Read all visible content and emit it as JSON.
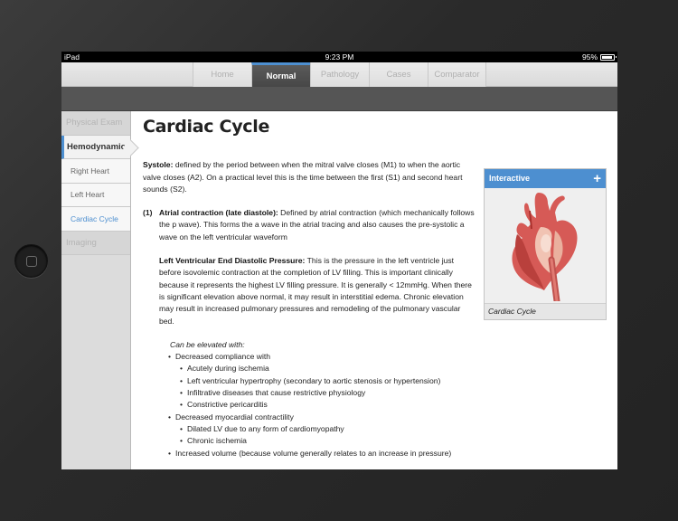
{
  "status": {
    "device": "iPad",
    "time": "9:23 PM",
    "battery": "95%"
  },
  "tabs": [
    {
      "label": "Home"
    },
    {
      "label": "Normal"
    },
    {
      "label": "Pathology"
    },
    {
      "label": "Cases"
    },
    {
      "label": "Comparator"
    }
  ],
  "active_tab": "Normal",
  "sidebar": {
    "items": [
      {
        "label": "Physical Exam"
      },
      {
        "label": "Hemodynamics"
      },
      {
        "label": "Right Heart"
      },
      {
        "label": "Left Heart"
      },
      {
        "label": "Cardiac Cycle"
      },
      {
        "label": "Imaging"
      }
    ]
  },
  "main": {
    "title": "Cardiac Cycle",
    "systole_label": "Systole:",
    "systole_text": " defined by the period between when the mitral valve closes (M1) to when the aortic valve closes (A2).  On a practical level this is the time between the first (S1) and second heart sounds (S2).",
    "item1_num": "(1)",
    "item1_label": "Atrial contraction (late diastole):",
    "item1_text": " Defined by atrial contraction (which mechanically follows the p wave). This forms the a wave in the atrial tracing and also causes the pre-systolic a wave on the left ventricular waveform",
    "lvedp_label": "Left Ventricular End Diastolic Pressure:",
    "lvedp_text": " This is the pressure in the left ventricle just before isovolemic contraction at the completion of LV filling.  This is important clinically because it represents the highest LV filling pressure.  It is generally < 12mmHg.  When there is significant elevation above normal, it may result in interstitial edema. Chronic elevation may result in increased pulmonary pressures and remodeling of the pulmonary vascular bed.",
    "elevated_heading": "Can be elevated with:",
    "bullets": [
      "Decreased compliance with",
      "Acutely during ischemia",
      "Left ventricular hypertrophy (secondary to aortic stenosis or hypertension)",
      "Infiltrative diseases that cause restrictive physiology",
      "Constrictive pericarditis",
      "Decreased myocardial contractility",
      "Dilated LV due to any form of cardiomyopathy",
      "Chronic ischemia",
      "Increased volume (because volume generally relates to an increase in pressure)"
    ]
  },
  "card": {
    "header": "Interactive",
    "plus_icon": "+",
    "caption": "Cardiac Cycle",
    "image": "heart-illustration"
  },
  "colors": {
    "accent": "#4d8fd0",
    "subbar": "#555555"
  }
}
